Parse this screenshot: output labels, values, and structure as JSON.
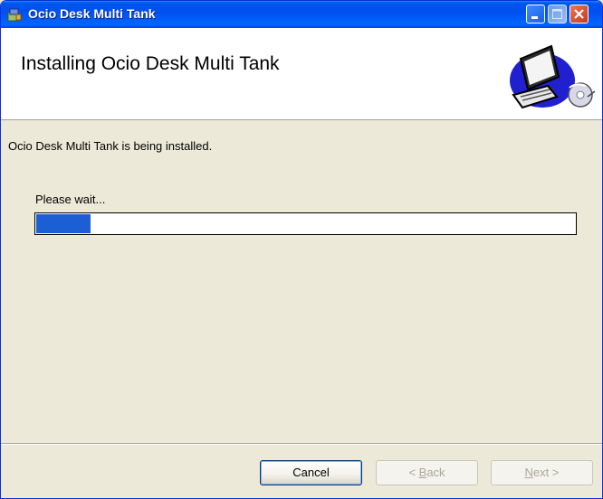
{
  "window": {
    "title": "Ocio Desk Multi Tank"
  },
  "header": {
    "title": "Installing Ocio Desk Multi Tank",
    "graphic": "computer-setup-icon"
  },
  "body": {
    "description": "Ocio Desk Multi Tank is being installed.",
    "status_label": "Please wait...",
    "progress_fraction": 0.1
  },
  "buttons": {
    "cancel": "Cancel",
    "back_accel": "B",
    "back_rest": "ack",
    "back_prefix": "< ",
    "next_accel": "N",
    "next_rest": "ext",
    "next_suffix": " >"
  },
  "colors": {
    "titlebar": "#0054e3",
    "progress_fill": "#1c5ed4",
    "dialog_bg": "#ece9d8"
  }
}
